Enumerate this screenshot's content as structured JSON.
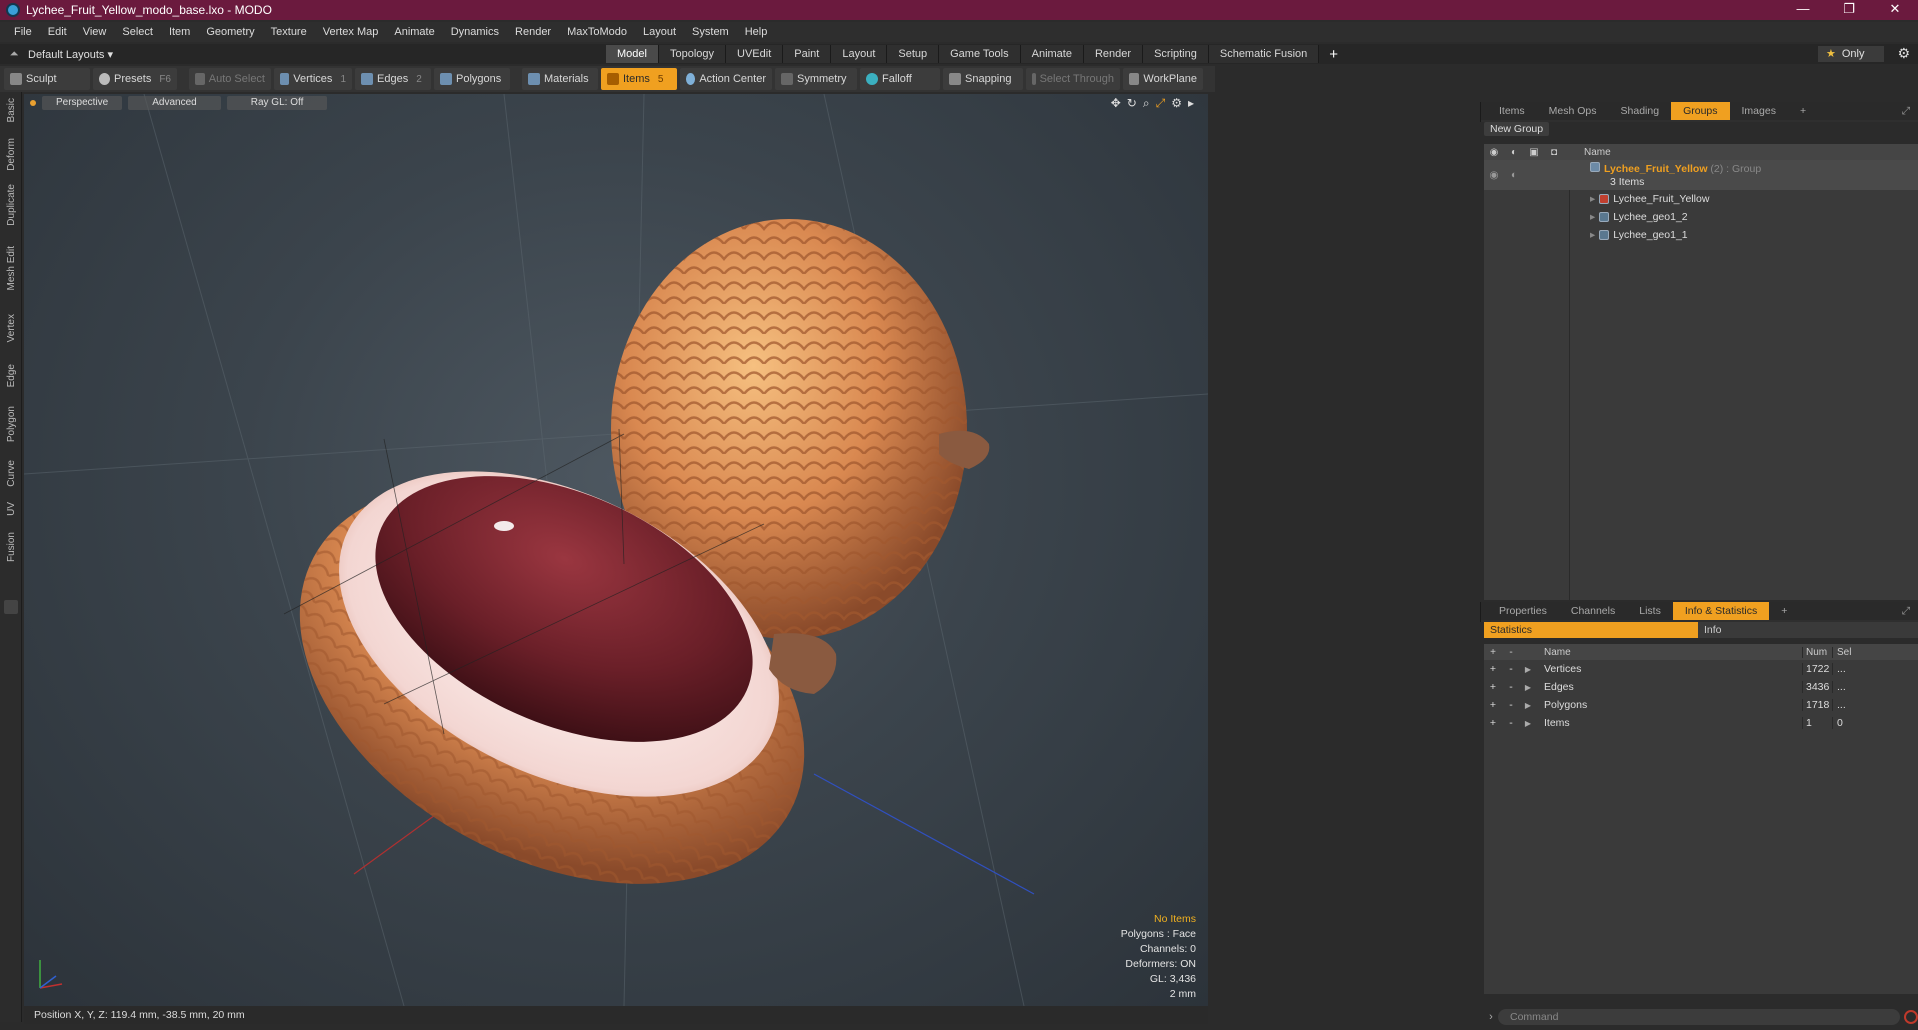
{
  "window": {
    "title": "Lychee_Fruit_Yellow_modo_base.lxo - MODO",
    "controls": [
      "—",
      "❐",
      "✕"
    ]
  },
  "menu": [
    "File",
    "Edit",
    "View",
    "Select",
    "Item",
    "Geometry",
    "Texture",
    "Vertex Map",
    "Animate",
    "Dynamics",
    "Render",
    "MaxToModo",
    "Layout",
    "System",
    "Help"
  ],
  "layouts": {
    "name": "Default Layouts ▾",
    "tabs": [
      "Model",
      "Topology",
      "UVEdit",
      "Paint",
      "Layout",
      "Setup",
      "Game Tools",
      "Animate",
      "Render",
      "Scripting",
      "Schematic Fusion"
    ],
    "active": "Model",
    "only_label": "Only"
  },
  "toolbar": {
    "sculpt": "Sculpt",
    "presets": "Presets",
    "presets_key": "F6",
    "auto_select": "Auto Select",
    "vertices": "Vertices",
    "vertices_key": "1",
    "edges": "Edges",
    "edges_key": "2",
    "polygons": "Polygons",
    "materials": "Materials",
    "items": "Items",
    "items_key": "5",
    "action_center": "Action Center",
    "symmetry": "Symmetry",
    "falloff": "Falloff",
    "snapping": "Snapping",
    "select_through": "Select Through",
    "workplane": "WorkPlane"
  },
  "side_tabs": [
    "Basic",
    "Deform",
    "Duplicate",
    "Mesh Edit",
    "Vertex",
    "Edge",
    "Polygon",
    "Curve",
    "UV",
    "Fusion"
  ],
  "viewport": {
    "view": "Perspective",
    "shading": "Advanced",
    "raygl": "Ray GL: Off",
    "stats": {
      "items": "No Items",
      "polygons": "Polygons : Face",
      "channels": "Channels: 0",
      "deformers": "Deformers: ON",
      "gl": "GL: 3,436",
      "scale": "2 mm"
    }
  },
  "status": {
    "position": "Position X, Y, Z:   119.4 mm, -38.5 mm, 20 mm"
  },
  "groups_panel": {
    "tabs": [
      "Items",
      "Mesh Ops",
      "Shading",
      "Groups",
      "Images"
    ],
    "active": "Groups",
    "new_group": "New Group",
    "name_header": "Name",
    "group": {
      "name": "Lychee_Fruit_Yellow",
      "count": "(2)",
      "type": ": Group",
      "items_label": "3 Items"
    },
    "children": [
      "Lychee_Fruit_Yellow",
      "Lychee_geo1_2",
      "Lychee_geo1_1"
    ]
  },
  "info_panel": {
    "tabs": [
      "Properties",
      "Channels",
      "Lists",
      "Info & Statistics"
    ],
    "active": "Info & Statistics",
    "statistics_tab": "Statistics",
    "info_tab": "Info",
    "headers": {
      "name": "Name",
      "num": "Num",
      "sel": "Sel"
    },
    "rows": [
      {
        "name": "Vertices",
        "num": "1722",
        "sel": "..."
      },
      {
        "name": "Edges",
        "num": "3436",
        "sel": "..."
      },
      {
        "name": "Polygons",
        "num": "1718",
        "sel": "..."
      },
      {
        "name": "Items",
        "num": "1",
        "sel": "0"
      }
    ]
  },
  "command": {
    "placeholder": "Command"
  },
  "colors": {
    "titlebar": "#6b1a3e",
    "accent": "#f0a020"
  }
}
